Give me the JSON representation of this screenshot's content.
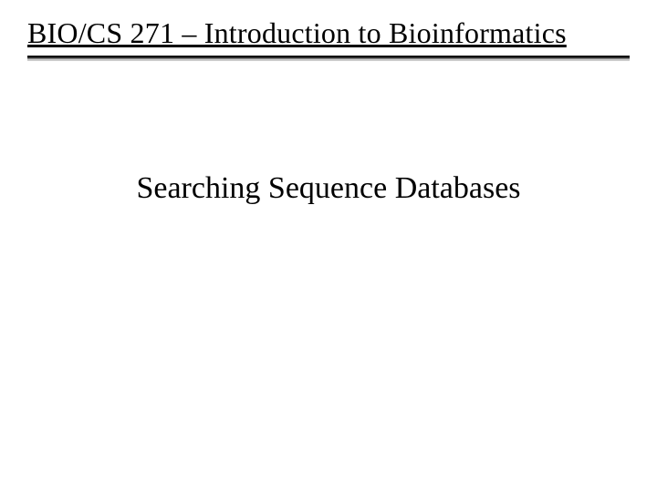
{
  "header": {
    "course_title": "BIO/CS 271 – Introduction to Bioinformatics"
  },
  "main": {
    "slide_title": "Searching Sequence Databases"
  }
}
